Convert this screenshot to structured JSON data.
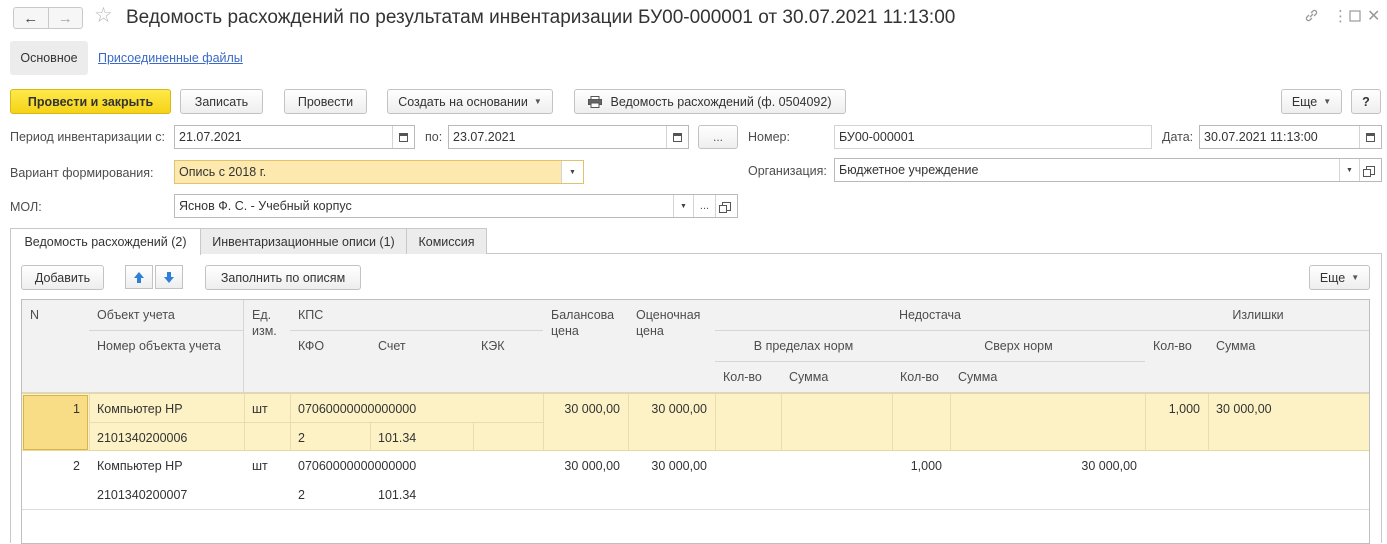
{
  "window": {
    "title": "Ведомость расхождений по результатам инвентаризации БУ00-000001 от 30.07.2021 11:13:00"
  },
  "nav": {
    "main": "Основное",
    "files": "Присоединенные файлы"
  },
  "toolbar": {
    "post_close": "Провести и закрыть",
    "save": "Записать",
    "post": "Провести",
    "create_based": "Создать на основании",
    "print_report": "Ведомость расхождений (ф. 0504092)",
    "more": "Еще",
    "help": "?"
  },
  "form": {
    "period_label": "Период инвентаризации с:",
    "period_from": "21.07.2021",
    "to_label": "по:",
    "period_to": "23.07.2021",
    "ellipsis": "...",
    "number_label": "Номер:",
    "number": "БУ00-000001",
    "date_label": "Дата:",
    "date": "30.07.2021 11:13:00",
    "variant_label": "Вариант формирования:",
    "variant": "Опись с 2018 г.",
    "org_label": "Организация:",
    "org": "Бюджетное учреждение",
    "mol_label": "МОЛ:",
    "mol": "Яснов Ф. С. - Учебный корпус"
  },
  "tabs": [
    {
      "label": "Ведомость расхождений (2)",
      "active": true
    },
    {
      "label": "Инвентаризационные описи (1)",
      "active": false
    },
    {
      "label": "Комиссия",
      "active": false
    }
  ],
  "table_toolbar": {
    "add": "Добавить",
    "fill": "Заполнить по описям",
    "more": "Еще"
  },
  "table": {
    "headers": {
      "n": "N",
      "object": "Объект учета",
      "object_num": "Номер объекта учета",
      "unit": "Ед. изм.",
      "kps": "КПС",
      "kfo": "КФО",
      "account": "Счет",
      "kek": "КЭК",
      "balance_price": "Балансова цена",
      "estimated_price": "Оценочная цена",
      "shortage": "Недостача",
      "within_norms": "В пределах норм",
      "above_norms": "Сверх норм",
      "qty": "Кол-во",
      "sum": "Сумма",
      "surplus": "Излишки"
    },
    "rows": [
      {
        "n": "1",
        "object": "Компьютер HP",
        "object_num": "2101340200006",
        "unit": "шт",
        "kps": "07060000000000000",
        "kfo": "2",
        "account": "101.34",
        "kek": "",
        "balance_price": "30 000,00",
        "estimated_price": "30 000,00",
        "within_qty": "",
        "within_sum": "",
        "above_qty": "",
        "above_sum": "",
        "surplus_qty": "1,000",
        "surplus_sum": "30 000,00",
        "selected": true
      },
      {
        "n": "2",
        "object": "Компьютер HP",
        "object_num": "2101340200007",
        "unit": "шт",
        "kps": "07060000000000000",
        "kfo": "2",
        "account": "101.34",
        "kek": "",
        "balance_price": "30 000,00",
        "estimated_price": "30 000,00",
        "within_qty": "",
        "within_sum": "",
        "above_qty": "1,000",
        "above_sum": "30 000,00",
        "surplus_qty": "",
        "surplus_sum": "",
        "selected": false
      }
    ]
  },
  "colors": {
    "primary_button": "#f5d317",
    "selected_row": "#fdf2c6",
    "selected_cell": "#f9dc86",
    "link": "#3b69c7",
    "header_bg": "#f2f2f2",
    "arrow_blue": "#2f7fd6"
  },
  "icons": [
    "back-arrow-icon",
    "forward-arrow-icon",
    "star-icon",
    "link-icon",
    "kebab-menu-icon",
    "maximize-icon",
    "close-icon",
    "print-icon",
    "calendar-icon",
    "dropdown-icon",
    "open-icon",
    "arrow-up-icon",
    "arrow-down-icon"
  ]
}
